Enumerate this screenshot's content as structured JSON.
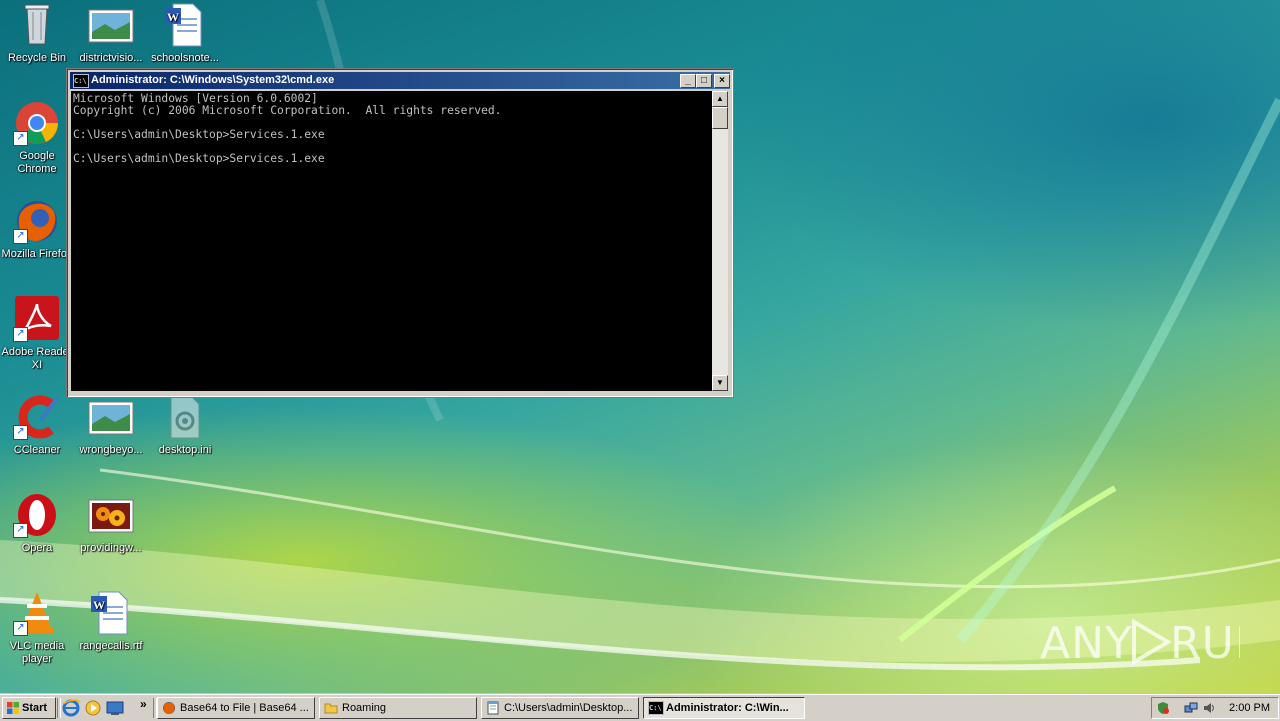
{
  "desktop": {
    "icons": [
      {
        "label": "Recycle Bin",
        "icon": "recycle-bin-icon"
      },
      {
        "label": "districtvisio...",
        "icon": "image-file-icon"
      },
      {
        "label": "schoolsnote...",
        "icon": "word-document-icon"
      },
      {
        "label": "Google Chrome",
        "icon": "chrome-icon"
      },
      {
        "label": "Mozilla Firefox",
        "icon": "firefox-icon"
      },
      {
        "label": "Adobe Reader XI",
        "icon": "adobe-reader-icon"
      },
      {
        "label": "CCleaner",
        "icon": "ccleaner-icon"
      },
      {
        "label": "wrongbeyo...",
        "icon": "image-file-icon"
      },
      {
        "label": "desktop.ini",
        "icon": "settings-file-icon"
      },
      {
        "label": "Opera",
        "icon": "opera-icon"
      },
      {
        "label": "providingw...",
        "icon": "image-file-icon"
      },
      {
        "label": "VLC media player",
        "icon": "vlc-icon"
      },
      {
        "label": "rangecalls.rtf",
        "icon": "word-document-icon"
      }
    ]
  },
  "cmd_window": {
    "title": "Administrator: C:\\Windows\\System32\\cmd.exe",
    "lines": [
      "Microsoft Windows [Version 6.0.6002]",
      "Copyright (c) 2006 Microsoft Corporation.  All rights reserved.",
      "",
      "C:\\Users\\admin\\Desktop>Services.1.exe",
      "",
      "C:\\Users\\admin\\Desktop>Services.1.exe"
    ],
    "minimize": "_",
    "maximize": "□",
    "close": "×"
  },
  "watermark": {
    "text": "ANY RUN"
  },
  "taskbar": {
    "start_label": "Start",
    "more": "»",
    "tasks": [
      {
        "label": "Base64 to File | Base64 ...",
        "icon": "firefox-icon",
        "active": false
      },
      {
        "label": "Roaming",
        "icon": "folder-icon",
        "active": false
      },
      {
        "label": "C:\\Users\\admin\\Desktop...",
        "icon": "notepad-icon",
        "active": false
      },
      {
        "label": "Administrator: C:\\Win...",
        "icon": "cmd-icon",
        "active": true
      }
    ],
    "clock": "2:00 PM"
  },
  "colors": {
    "title_start": "#0a246a",
    "title_end": "#3a6ea5",
    "console_text": "#c0c0c0"
  }
}
